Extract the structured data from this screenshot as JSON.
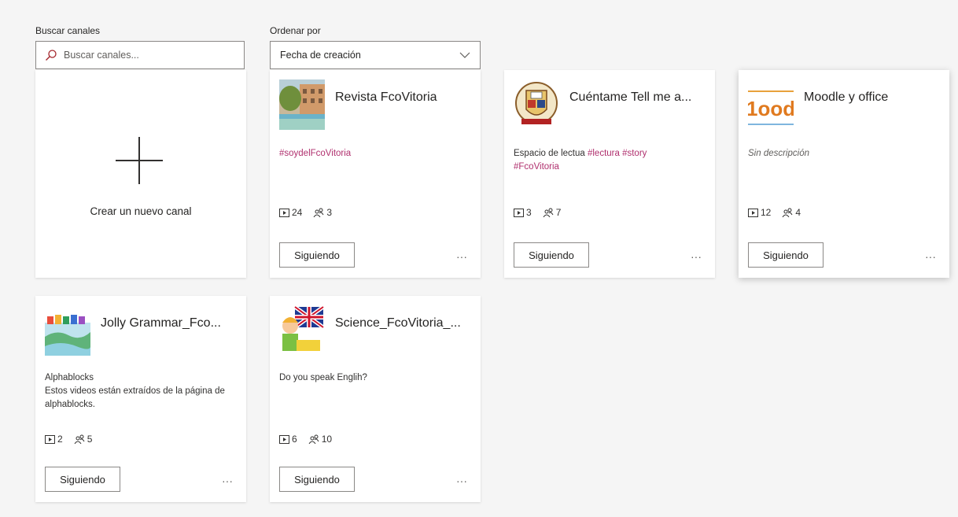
{
  "search": {
    "label": "Buscar canales",
    "placeholder": "Buscar canales..."
  },
  "sort": {
    "label": "Ordenar por",
    "value": "Fecha de creación"
  },
  "create": {
    "label": "Crear un nuevo canal"
  },
  "icons": {
    "search": "search-icon",
    "chevron": "chevron-down-icon",
    "plus": "plus-icon",
    "video": "video-icon",
    "followers": "followers-icon",
    "more": "more-icon"
  },
  "colors": {
    "tag": "#b0306e",
    "border": "#8a8886"
  },
  "channels": [
    {
      "title": "Revista FcoVitoria",
      "desc_tags": "#soydelFcoVitoria",
      "videos": "24",
      "followers": "3",
      "button": "Siguiendo",
      "more": "···"
    },
    {
      "title": "Cuéntame Tell me a...",
      "desc_text": "Espacio de lectua ",
      "desc_tags": "#lectura #story",
      "desc_tags2": "#FcoVitoria",
      "videos": "3",
      "followers": "7",
      "button": "Siguiendo",
      "more": "···"
    },
    {
      "title": "Moodle y office",
      "desc": "Sin descripción",
      "thumb_text": "1ood",
      "videos": "12",
      "followers": "4",
      "button": "Siguiendo",
      "more": "···"
    },
    {
      "title": "Jolly Grammar_Fco...",
      "desc_line1": "Alphablocks",
      "desc_line2": "Estos videos están extraídos de la página de alphablocks.",
      "videos": "2",
      "followers": "5",
      "button": "Siguiendo",
      "more": "···"
    },
    {
      "title": "Science_FcoVitoria_...",
      "desc": "Do you speak Englih?",
      "videos": "6",
      "followers": "10",
      "button": "Siguiendo",
      "more": "···"
    }
  ]
}
